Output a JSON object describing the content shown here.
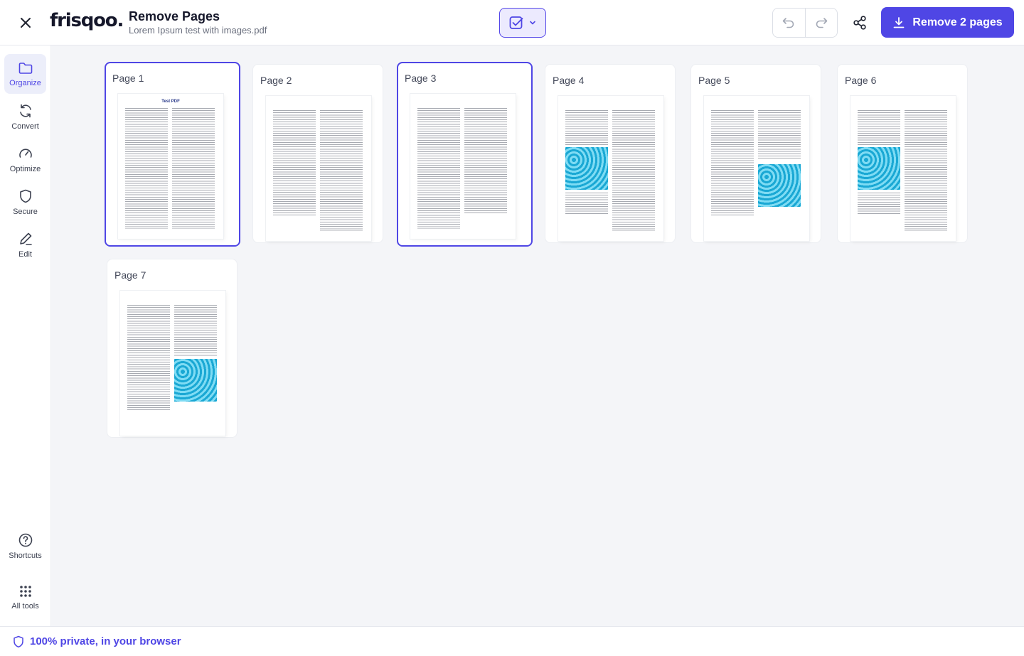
{
  "header": {
    "logo": "frisqoo.",
    "title": "Remove Pages",
    "filename": "Lorem Ipsum test with images.pdf",
    "remove_label": "Remove 2 pages",
    "accent": "#4f46e5"
  },
  "sidebar": {
    "items": [
      {
        "label": "Organize",
        "icon": "folder-icon"
      },
      {
        "label": "Convert",
        "icon": "refresh-icon"
      },
      {
        "label": "Optimize",
        "icon": "gauge-icon"
      },
      {
        "label": "Secure",
        "icon": "shield-icon"
      },
      {
        "label": "Edit",
        "icon": "pencil-icon"
      }
    ],
    "bottom": [
      {
        "label": "Shortcuts",
        "icon": "question-icon"
      },
      {
        "label": "All tools",
        "icon": "grid-icon"
      }
    ]
  },
  "pages": [
    {
      "label": "Page 1",
      "selected": true,
      "doc_title": "Test PDF"
    },
    {
      "label": "Page 2",
      "selected": false
    },
    {
      "label": "Page 3",
      "selected": true
    },
    {
      "label": "Page 4",
      "selected": false
    },
    {
      "label": "Page 5",
      "selected": false
    },
    {
      "label": "Page 6",
      "selected": false
    },
    {
      "label": "Page 7",
      "selected": false
    }
  ],
  "footer": {
    "text": "100% private, in your browser"
  }
}
